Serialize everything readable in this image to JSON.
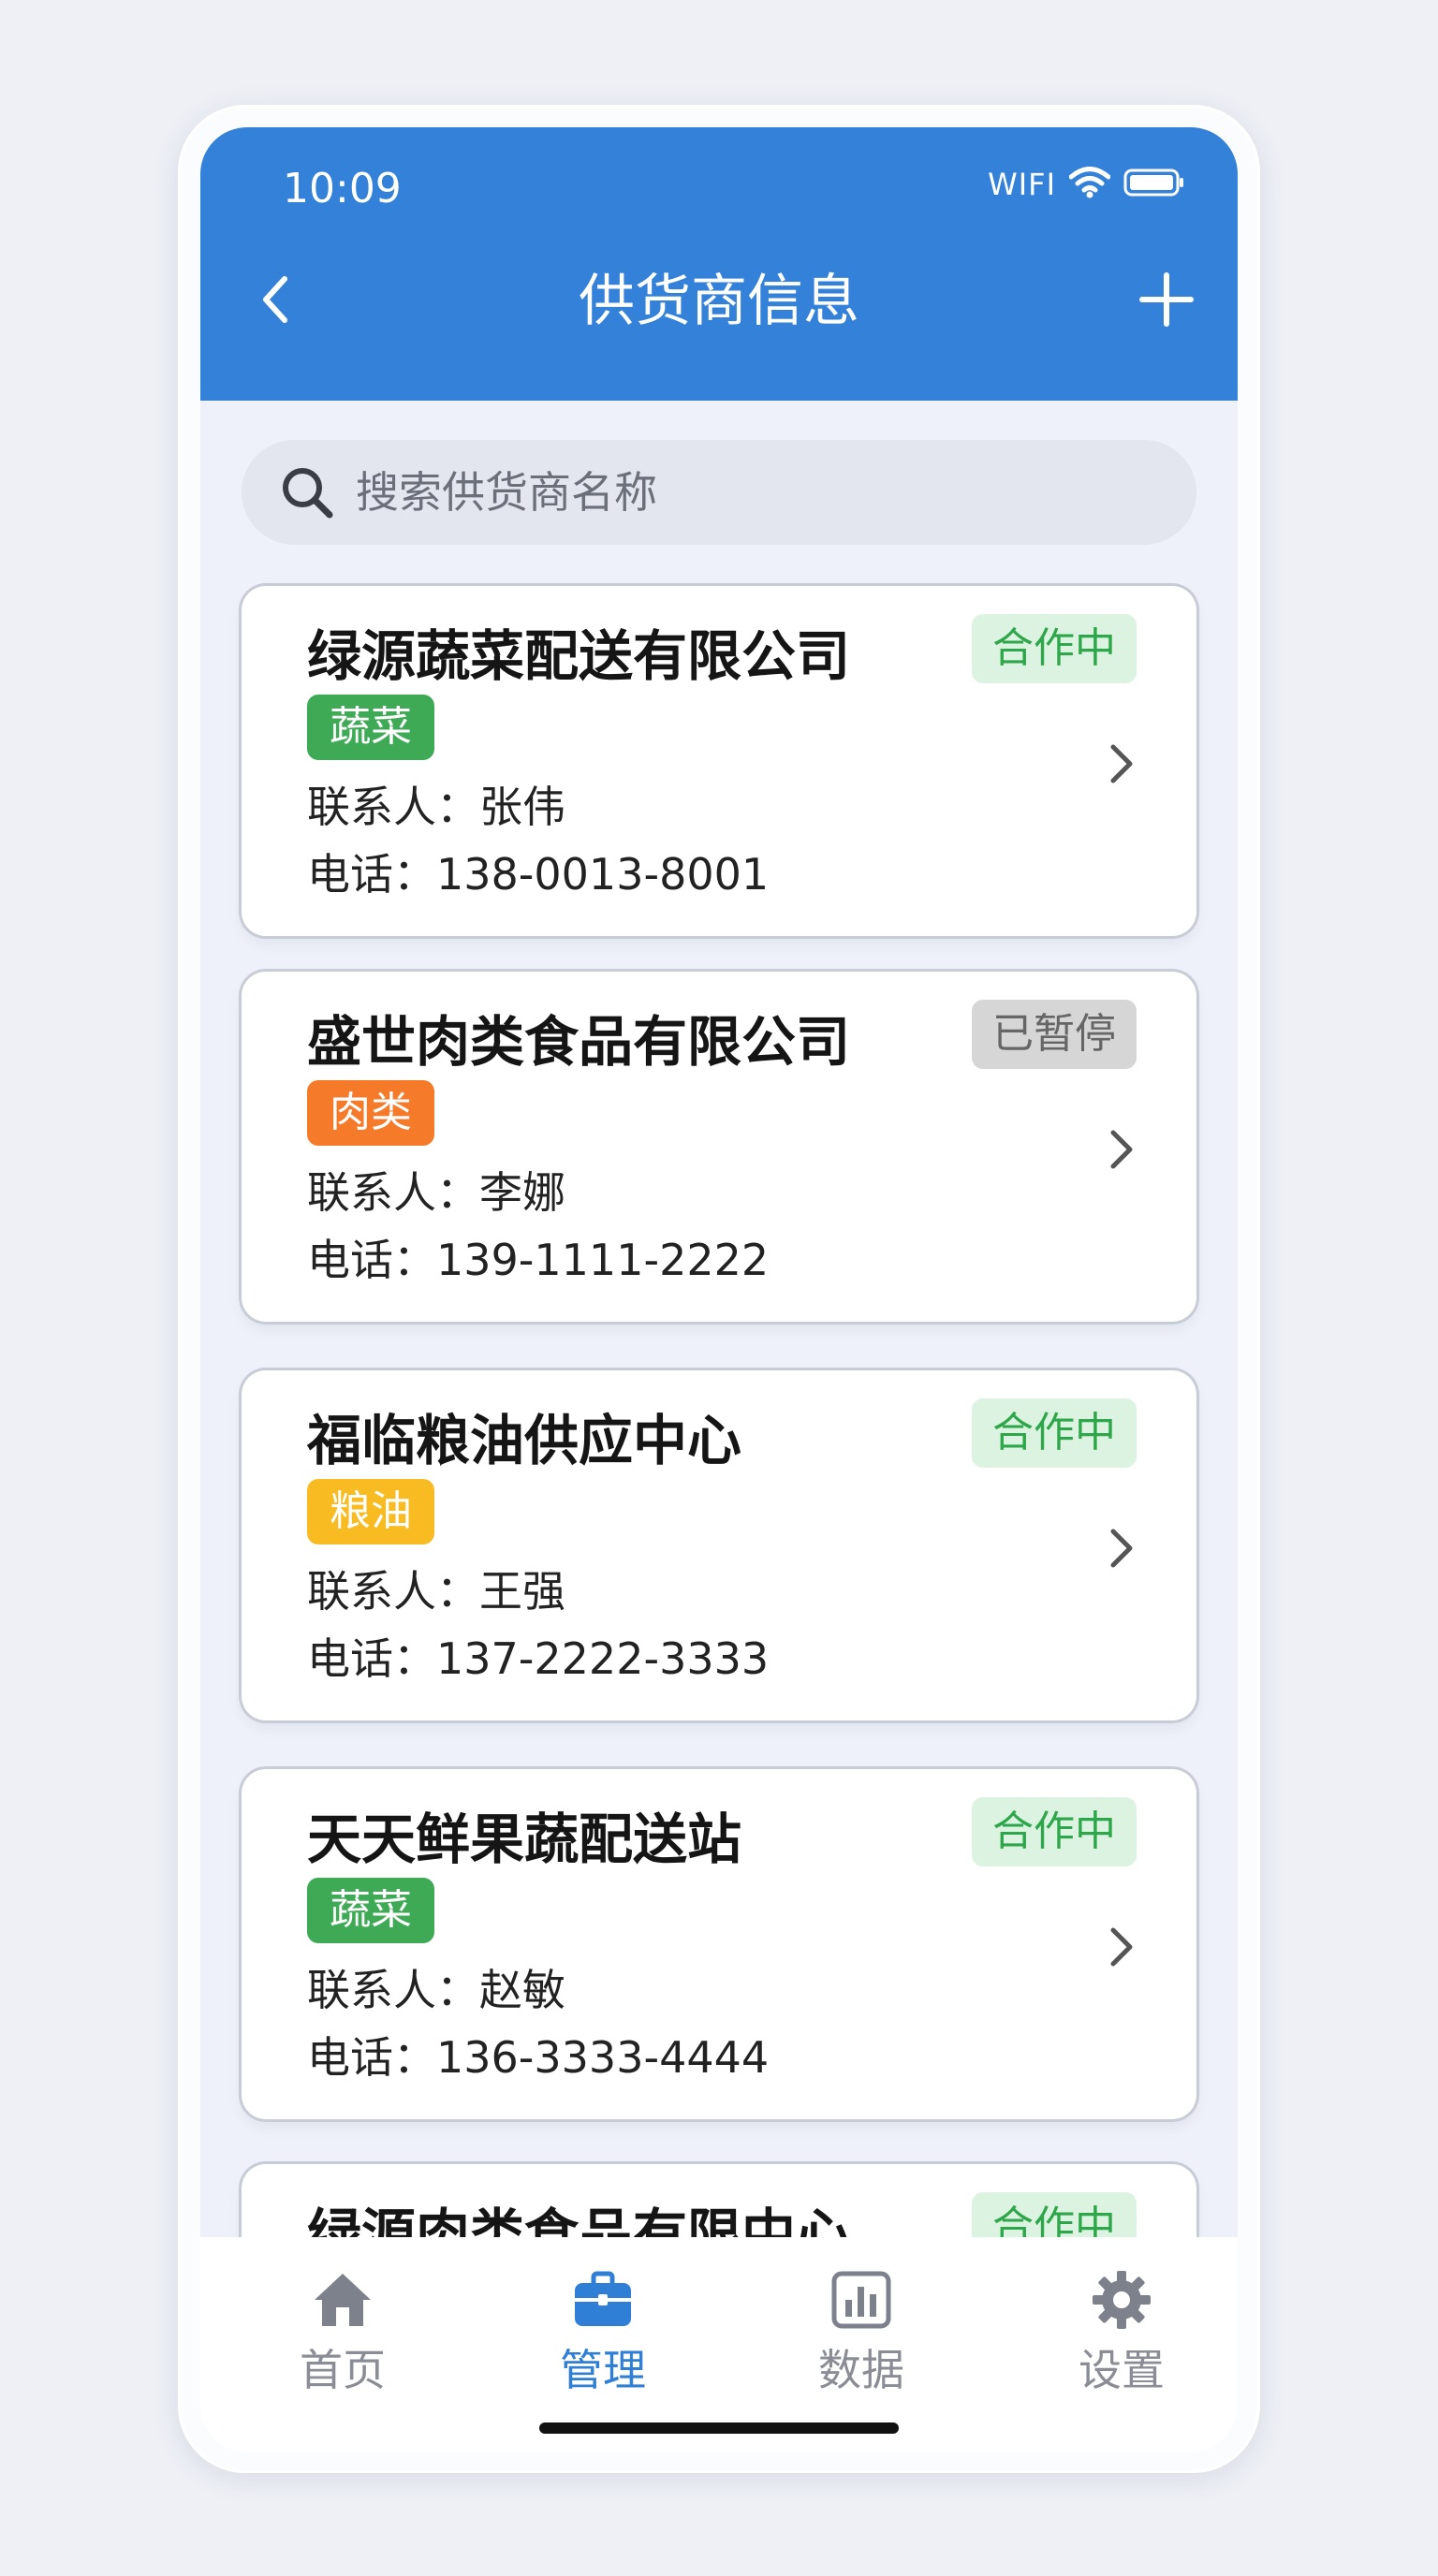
{
  "status_bar": {
    "time": "10:09",
    "network": "WIFI"
  },
  "nav": {
    "title": "供货商信息"
  },
  "search": {
    "placeholder": "搜索供货商名称"
  },
  "suppliers": [
    {
      "name": "绿源蔬菜配送有限公司",
      "status": "合作中",
      "category": "蔬菜",
      "contact": "联系人：张伟",
      "phone": "电话：138-0013-8001"
    },
    {
      "name": "盛世肉类食品有限公司",
      "status": "已暂停",
      "category": "肉类",
      "contact": "联系人：李娜",
      "phone": "电话：139-1111-2222"
    },
    {
      "name": "福临粮油供应中心",
      "status": "合作中",
      "category": "粮油",
      "contact": "联系人：王强",
      "phone": "电话：137-2222-3333"
    },
    {
      "name": "天天鲜果蔬配送站",
      "status": "合作中",
      "category": "蔬菜",
      "contact": "联系人：赵敏",
      "phone": "电话：136-3333-4444"
    },
    {
      "name": "绿源肉类食品有限中心",
      "status": "合作中",
      "category": "",
      "contact": "",
      "phone": ""
    }
  ],
  "colors": {
    "header": "#3381d9",
    "category_vegetable": "#3faa55",
    "category_meat": "#f57a2a",
    "category_grain": "#f8bc22",
    "status_active_text": "#2ea64a",
    "status_paused_text": "#666666",
    "tab_active": "#2f7fd6"
  },
  "tabbar": {
    "tabs": [
      {
        "label": "首页",
        "icon": "home-icon",
        "active": false
      },
      {
        "label": "管理",
        "icon": "briefcase-icon",
        "active": true
      },
      {
        "label": "数据",
        "icon": "chart-icon",
        "active": false
      },
      {
        "label": "设置",
        "icon": "gear-icon",
        "active": false
      }
    ]
  }
}
